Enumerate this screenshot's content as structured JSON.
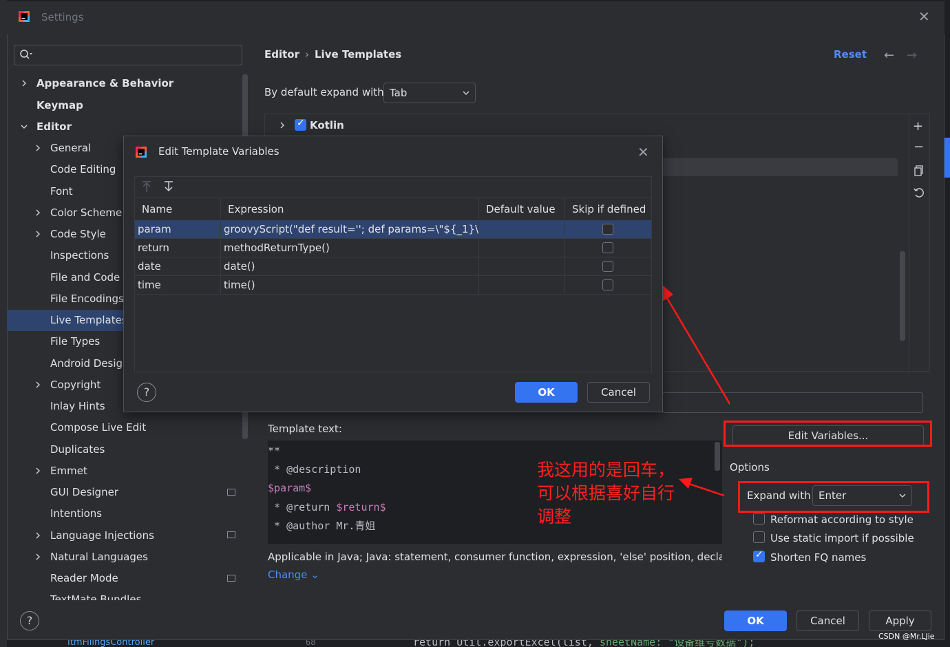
{
  "window": {
    "title": "Settings",
    "close_glyph": "✕"
  },
  "search": {
    "value": "",
    "placeholder": ""
  },
  "sidebar": {
    "items": [
      {
        "label": "Appearance & Behavior"
      },
      {
        "label": "Keymap"
      },
      {
        "label": "Editor"
      },
      {
        "label": "General"
      },
      {
        "label": "Code Editing"
      },
      {
        "label": "Font"
      },
      {
        "label": "Color Scheme"
      },
      {
        "label": "Code Style"
      },
      {
        "label": "Inspections"
      },
      {
        "label": "File and Code Templates"
      },
      {
        "label": "File Encodings"
      },
      {
        "label": "Live Templates"
      },
      {
        "label": "File Types"
      },
      {
        "label": "Android Design Tools"
      },
      {
        "label": "Copyright"
      },
      {
        "label": "Inlay Hints"
      },
      {
        "label": "Compose Live Edit"
      },
      {
        "label": "Duplicates"
      },
      {
        "label": "Emmet"
      },
      {
        "label": "GUI Designer"
      },
      {
        "label": "Intentions"
      },
      {
        "label": "Language Injections"
      },
      {
        "label": "Natural Languages"
      },
      {
        "label": "Reader Mode"
      },
      {
        "label": "TextMate Bundles"
      }
    ],
    "selected": "Live Templates"
  },
  "header": {
    "breadcrumb": [
      "Editor",
      "Live Templates"
    ],
    "separator": "›",
    "reset_label": "Reset",
    "back_glyph": "←",
    "forward_glyph": "→"
  },
  "main": {
    "default_expand_label": "By default expand with",
    "default_expand_value": "Tab",
    "template_groups": [
      {
        "label": "Kotlin",
        "checked": true
      }
    ],
    "template_text_label": "Template text:",
    "template_lines": [
      {
        "pre": "**",
        "var": ""
      },
      {
        "pre": " * @description",
        "var": ""
      },
      {
        "pre": "",
        "var": "$param$"
      },
      {
        "pre": " * @return ",
        "var": "$return$"
      },
      {
        "pre": " * @author Mr.青姐",
        "var": ""
      }
    ],
    "applicable_text": "Applicable in Java; Java: statement, consumer function, expression, 'else' position, declaration",
    "change_label": "Change",
    "edit_variables_label": "Edit Variables...",
    "options": {
      "title": "Options",
      "expand_with_label": "Expand with",
      "expand_with_value": "Enter",
      "checkboxes": [
        {
          "label": "Reformat according to style",
          "checked": false
        },
        {
          "label": "Use static import if possible",
          "checked": false
        },
        {
          "label": "Shorten FQ names",
          "checked": true
        }
      ]
    }
  },
  "footer": {
    "ok_label": "OK",
    "cancel_label": "Cancel",
    "apply_label": "Apply",
    "help_glyph": "?"
  },
  "dialog": {
    "title": "Edit Template Variables",
    "close_glyph": "✕",
    "columns": [
      "Name",
      "Expression",
      "Default value",
      "Skip if defined"
    ],
    "rows": [
      {
        "name": "param",
        "expression": "groovyScript(\"def result=''; def params=\\\"${_1}\\...",
        "default": "",
        "skip": false
      },
      {
        "name": "return",
        "expression": "methodReturnType()",
        "default": "",
        "skip": false
      },
      {
        "name": "date",
        "expression": "date()",
        "default": "",
        "skip": false
      },
      {
        "name": "time",
        "expression": "time()",
        "default": "",
        "skip": false
      }
    ],
    "ok_label": "OK",
    "cancel_label": "Cancel",
    "help_glyph": "?"
  },
  "annotation": {
    "text": "我这用的是回车，\n可以根据喜好自行\n调整",
    "color": "#ff1a1a"
  },
  "background_ide": {
    "code": "return Util.exportExcel(list,",
    "string": "sheetName: \"设备维号数据\");",
    "line_number": "68",
    "class_tab": "ItmFilingsController"
  },
  "watermark": "CSDN @Mr.LJie",
  "colors": {
    "accent": "#3574f0",
    "selection": "#2e436e",
    "link": "#548af7",
    "annotation_red": "#ff1a1a"
  }
}
